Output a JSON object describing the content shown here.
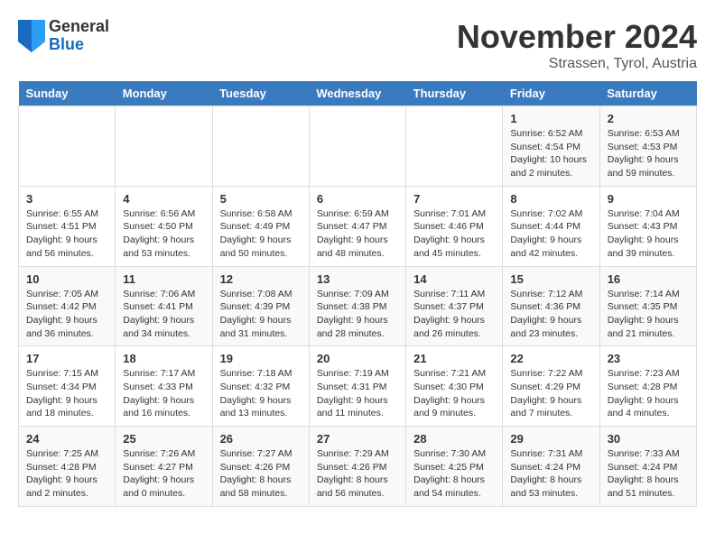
{
  "logo": {
    "general": "General",
    "blue": "Blue"
  },
  "header": {
    "month": "November 2024",
    "location": "Strassen, Tyrol, Austria"
  },
  "weekdays": [
    "Sunday",
    "Monday",
    "Tuesday",
    "Wednesday",
    "Thursday",
    "Friday",
    "Saturday"
  ],
  "weeks": [
    [
      {
        "day": "",
        "info": ""
      },
      {
        "day": "",
        "info": ""
      },
      {
        "day": "",
        "info": ""
      },
      {
        "day": "",
        "info": ""
      },
      {
        "day": "",
        "info": ""
      },
      {
        "day": "1",
        "info": "Sunrise: 6:52 AM\nSunset: 4:54 PM\nDaylight: 10 hours and 2 minutes."
      },
      {
        "day": "2",
        "info": "Sunrise: 6:53 AM\nSunset: 4:53 PM\nDaylight: 9 hours and 59 minutes."
      }
    ],
    [
      {
        "day": "3",
        "info": "Sunrise: 6:55 AM\nSunset: 4:51 PM\nDaylight: 9 hours and 56 minutes."
      },
      {
        "day": "4",
        "info": "Sunrise: 6:56 AM\nSunset: 4:50 PM\nDaylight: 9 hours and 53 minutes."
      },
      {
        "day": "5",
        "info": "Sunrise: 6:58 AM\nSunset: 4:49 PM\nDaylight: 9 hours and 50 minutes."
      },
      {
        "day": "6",
        "info": "Sunrise: 6:59 AM\nSunset: 4:47 PM\nDaylight: 9 hours and 48 minutes."
      },
      {
        "day": "7",
        "info": "Sunrise: 7:01 AM\nSunset: 4:46 PM\nDaylight: 9 hours and 45 minutes."
      },
      {
        "day": "8",
        "info": "Sunrise: 7:02 AM\nSunset: 4:44 PM\nDaylight: 9 hours and 42 minutes."
      },
      {
        "day": "9",
        "info": "Sunrise: 7:04 AM\nSunset: 4:43 PM\nDaylight: 9 hours and 39 minutes."
      }
    ],
    [
      {
        "day": "10",
        "info": "Sunrise: 7:05 AM\nSunset: 4:42 PM\nDaylight: 9 hours and 36 minutes."
      },
      {
        "day": "11",
        "info": "Sunrise: 7:06 AM\nSunset: 4:41 PM\nDaylight: 9 hours and 34 minutes."
      },
      {
        "day": "12",
        "info": "Sunrise: 7:08 AM\nSunset: 4:39 PM\nDaylight: 9 hours and 31 minutes."
      },
      {
        "day": "13",
        "info": "Sunrise: 7:09 AM\nSunset: 4:38 PM\nDaylight: 9 hours and 28 minutes."
      },
      {
        "day": "14",
        "info": "Sunrise: 7:11 AM\nSunset: 4:37 PM\nDaylight: 9 hours and 26 minutes."
      },
      {
        "day": "15",
        "info": "Sunrise: 7:12 AM\nSunset: 4:36 PM\nDaylight: 9 hours and 23 minutes."
      },
      {
        "day": "16",
        "info": "Sunrise: 7:14 AM\nSunset: 4:35 PM\nDaylight: 9 hours and 21 minutes."
      }
    ],
    [
      {
        "day": "17",
        "info": "Sunrise: 7:15 AM\nSunset: 4:34 PM\nDaylight: 9 hours and 18 minutes."
      },
      {
        "day": "18",
        "info": "Sunrise: 7:17 AM\nSunset: 4:33 PM\nDaylight: 9 hours and 16 minutes."
      },
      {
        "day": "19",
        "info": "Sunrise: 7:18 AM\nSunset: 4:32 PM\nDaylight: 9 hours and 13 minutes."
      },
      {
        "day": "20",
        "info": "Sunrise: 7:19 AM\nSunset: 4:31 PM\nDaylight: 9 hours and 11 minutes."
      },
      {
        "day": "21",
        "info": "Sunrise: 7:21 AM\nSunset: 4:30 PM\nDaylight: 9 hours and 9 minutes."
      },
      {
        "day": "22",
        "info": "Sunrise: 7:22 AM\nSunset: 4:29 PM\nDaylight: 9 hours and 7 minutes."
      },
      {
        "day": "23",
        "info": "Sunrise: 7:23 AM\nSunset: 4:28 PM\nDaylight: 9 hours and 4 minutes."
      }
    ],
    [
      {
        "day": "24",
        "info": "Sunrise: 7:25 AM\nSunset: 4:28 PM\nDaylight: 9 hours and 2 minutes."
      },
      {
        "day": "25",
        "info": "Sunrise: 7:26 AM\nSunset: 4:27 PM\nDaylight: 9 hours and 0 minutes."
      },
      {
        "day": "26",
        "info": "Sunrise: 7:27 AM\nSunset: 4:26 PM\nDaylight: 8 hours and 58 minutes."
      },
      {
        "day": "27",
        "info": "Sunrise: 7:29 AM\nSunset: 4:26 PM\nDaylight: 8 hours and 56 minutes."
      },
      {
        "day": "28",
        "info": "Sunrise: 7:30 AM\nSunset: 4:25 PM\nDaylight: 8 hours and 54 minutes."
      },
      {
        "day": "29",
        "info": "Sunrise: 7:31 AM\nSunset: 4:24 PM\nDaylight: 8 hours and 53 minutes."
      },
      {
        "day": "30",
        "info": "Sunrise: 7:33 AM\nSunset: 4:24 PM\nDaylight: 8 hours and 51 minutes."
      }
    ]
  ]
}
